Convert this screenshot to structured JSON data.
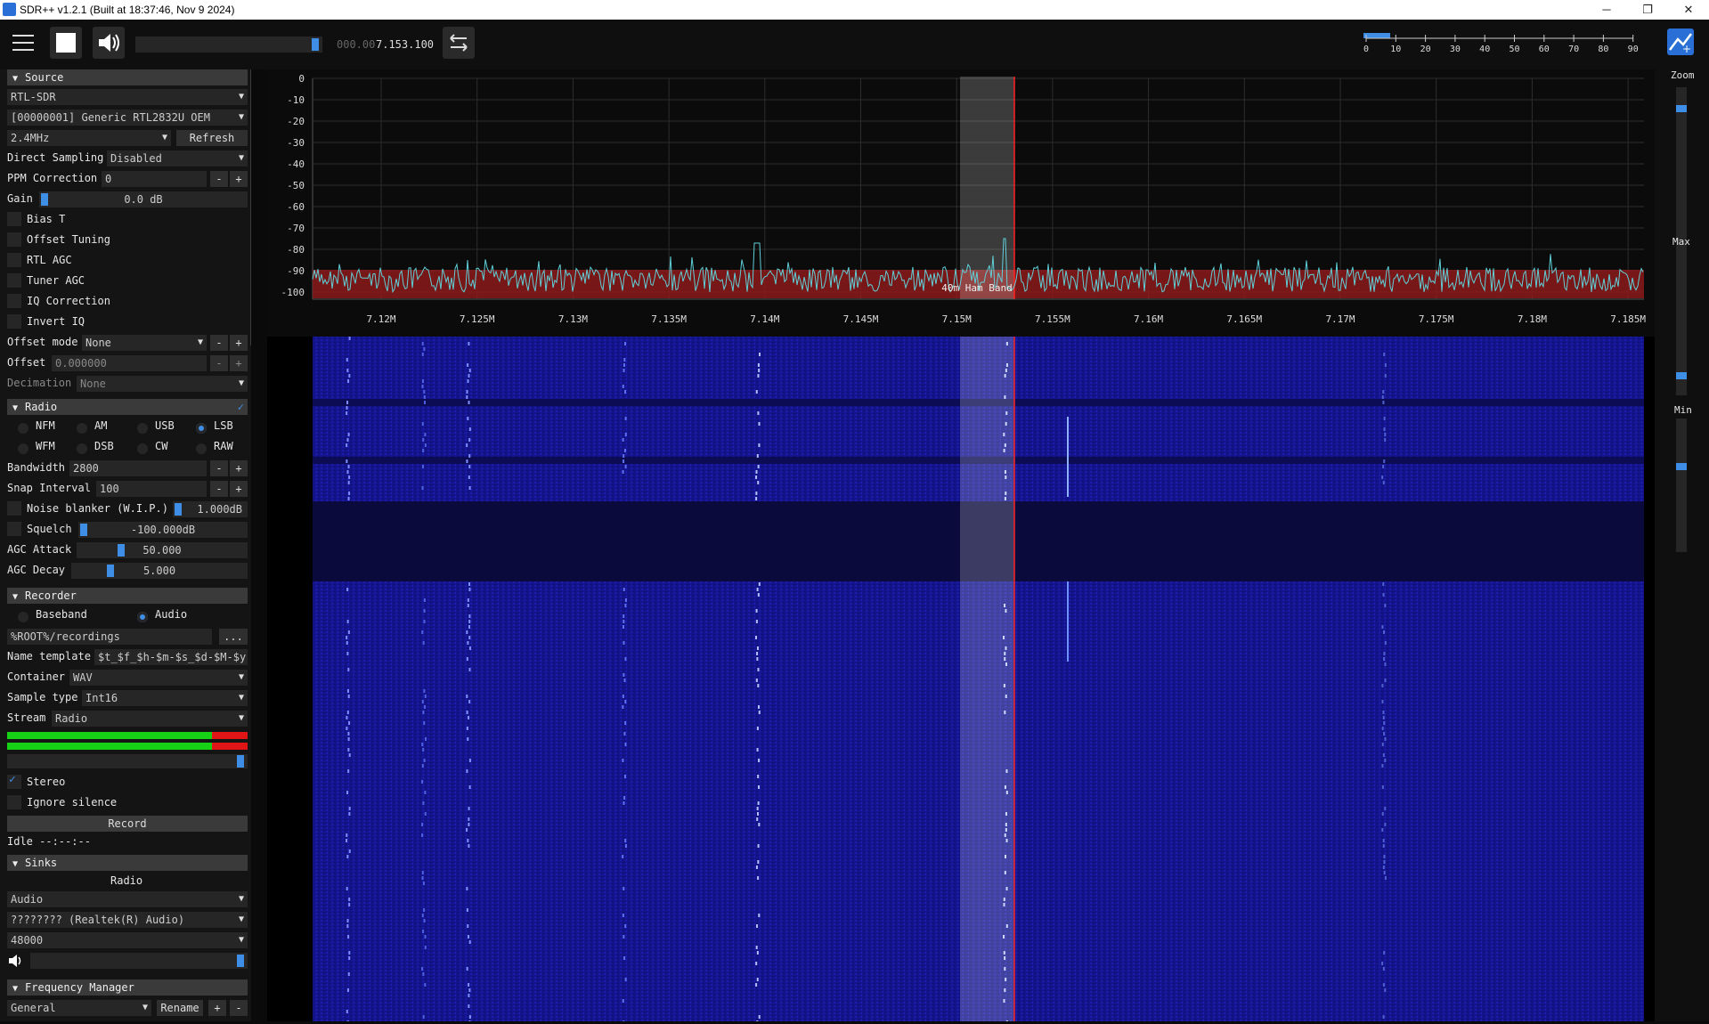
{
  "window": {
    "title": "SDR++ v1.2.1 (Built at 18:37:46, Nov  9 2024)"
  },
  "toolbar": {
    "frequency_dim": "000.00",
    "frequency": "7.153.100",
    "snr_ticks": [
      "0",
      "10",
      "20",
      "30",
      "40",
      "50",
      "60",
      "70",
      "80",
      "90"
    ]
  },
  "source": {
    "header": "Source",
    "device_type": "RTL-SDR",
    "device": "[00000001] Generic RTL2832U OEM",
    "samplerate": "2.4MHz",
    "refresh": "Refresh",
    "direct_sampling_label": "Direct Sampling",
    "direct_sampling": "Disabled",
    "ppm_label": "PPM Correction",
    "ppm": "0",
    "gain_label": "Gain",
    "gain": "0.0 dB",
    "checks": [
      "Bias T",
      "Offset Tuning",
      "RTL AGC",
      "Tuner AGC",
      "IQ Correction",
      "Invert IQ"
    ],
    "offset_mode_label": "Offset mode",
    "offset_mode": "None",
    "offset_label": "Offset",
    "offset": "0.000000",
    "decimation_label": "Decimation",
    "decimation": "None"
  },
  "radio": {
    "header": "Radio",
    "modes_row1": [
      "NFM",
      "AM",
      "USB",
      "LSB"
    ],
    "modes_row2": [
      "WFM",
      "DSB",
      "CW",
      "RAW"
    ],
    "selected": "LSB",
    "bandwidth_label": "Bandwidth",
    "bandwidth": "2800",
    "snap_label": "Snap Interval",
    "snap": "100",
    "nb_label": "Noise blanker (W.I.P.)",
    "nb": "1.000dB",
    "squelch_label": "Squelch",
    "squelch": "-100.000dB",
    "agc_attack_label": "AGC Attack",
    "agc_attack": "50.000",
    "agc_decay_label": "AGC Decay",
    "agc_decay": "5.000"
  },
  "recorder": {
    "header": "Recorder",
    "mode1": "Baseband",
    "mode2": "Audio",
    "path": "%ROOT%/recordings",
    "browse": "...",
    "name_template_label": "Name template",
    "name_template": "$t_$f_$h-$m-$s_$d-$M-$y",
    "container_label": "Container",
    "container": "WAV",
    "sample_type_label": "Sample type",
    "sample_type": "Int16",
    "stream_label": "Stream",
    "stream": "Radio",
    "stereo": "Stereo",
    "ignore_silence": "Ignore silence",
    "record": "Record",
    "status": "Idle --:--:--"
  },
  "sinks": {
    "header": "Sinks",
    "radio_label": "Radio",
    "sink_type": "Audio",
    "device": "???????? (Realtek(R) Audio)",
    "samplerate": "48000"
  },
  "freq_manager": {
    "header": "Frequency Manager",
    "list": "General",
    "rename": "Rename",
    "add": "+",
    "remove": "-"
  },
  "fft": {
    "db_ticks": [
      "0",
      "-10",
      "-20",
      "-30",
      "-40",
      "-50",
      "-60",
      "-70",
      "-80",
      "-90",
      "-100"
    ],
    "freq_ticks": [
      "7.12M",
      "7.125M",
      "7.13M",
      "7.135M",
      "7.14M",
      "7.145M",
      "7.15M",
      "7.155M",
      "7.16M",
      "7.165M",
      "7.17M",
      "7.175M",
      "7.18M",
      "7.185M"
    ],
    "band_label": "40m Ham Band"
  },
  "right": {
    "zoom": "Zoom",
    "max": "Max",
    "min": "Min"
  },
  "colors": {
    "accent": "#3f8ee6",
    "waterfall": "#14148c",
    "band": "#8b1a1a",
    "vfo_line": "#ff2222",
    "trace": "#5fd0d8"
  }
}
